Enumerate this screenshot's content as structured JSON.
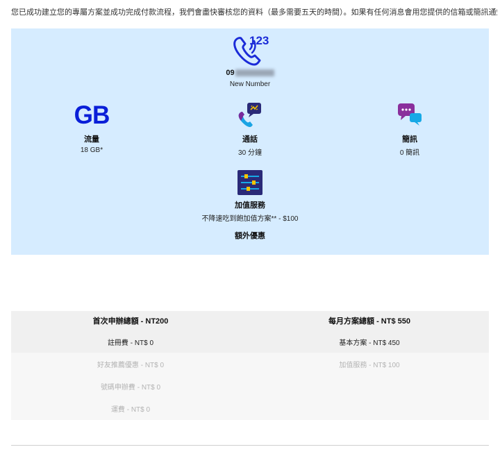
{
  "intro_text": "您已成功建立您的專屬方案並成功完成付款流程，我們會盡快審核您的資料（最多需要五天的時間）。如果有任何消息會用您提供的信箱或簡訊通知您。",
  "phone": {
    "icon": "phone-123-icon",
    "number_prefix": "09",
    "number_label": "New Number"
  },
  "features": {
    "data": {
      "icon_text": "GB",
      "title": "流量",
      "value": "18 GB*"
    },
    "call": {
      "icon": "phone-chat-icon",
      "title": "通話",
      "value": "30 分鐘"
    },
    "sms": {
      "icon": "chat-bubbles-icon",
      "title": "簡訊",
      "value": "0 簡訊"
    },
    "addon": {
      "icon": "sliders-icon",
      "title": "加值服務",
      "value": "不降速吃到飽加值方案** - $100"
    }
  },
  "extra_title": "額外優惠",
  "summary": {
    "left": {
      "heading": "首次申辦總額 - NT200",
      "rows": [
        {
          "label": "註冊費 - NT$ 0",
          "muted": false
        },
        {
          "label": "好友推薦優惠 - NT$ 0",
          "muted": true
        },
        {
          "label": "號碼申辦費 - NT$ 0",
          "muted": true
        },
        {
          "label": "運費 - NT$ 0",
          "muted": true
        }
      ]
    },
    "right": {
      "heading": "每月方案總額 - NT$ 550",
      "rows": [
        {
          "label": "基本方案 - NT$ 450",
          "muted": false
        },
        {
          "label": "加值服務 - NT$ 100",
          "muted": true
        }
      ]
    }
  },
  "colors": {
    "panel_bg": "#d6ecff",
    "gb_blue": "#0a1fd8",
    "icon_purple": "#7a2a9c",
    "icon_navy": "#2a2a78",
    "icon_cyan": "#17a9e6"
  }
}
